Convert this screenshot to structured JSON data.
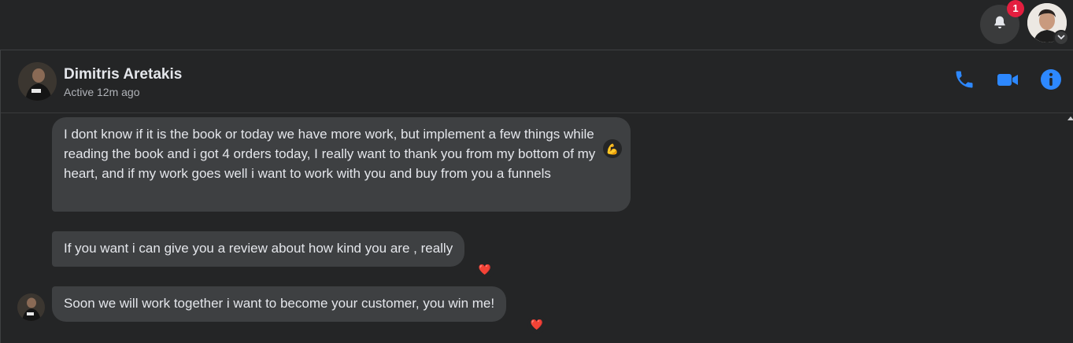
{
  "topbar": {
    "notifications": {
      "icon": "bell-icon",
      "count": "1"
    },
    "profile": {
      "icon": "chevron-down-icon"
    }
  },
  "conversation": {
    "contact": {
      "name": "Dimitris Aretakis",
      "status": "Active 12m ago"
    },
    "actions": [
      {
        "icon": "phone-icon"
      },
      {
        "icon": "video-icon"
      },
      {
        "icon": "info-icon"
      }
    ],
    "accent_color": "#2d88ff",
    "messages": [
      {
        "text": "I dont know if it is the book or today we have more work, but implement a few things while reading the book and i got 4 orders today, I really want to thank you from my bottom of my heart, and if my work goes well i want to work with you and buy from you a funnels",
        "reaction": "💪"
      },
      {
        "text": "If you want i can give you a review about how kind you are , really",
        "reaction": "❤️"
      },
      {
        "text": "Soon we will work together i want to become your customer, you win me!",
        "reaction": "❤️"
      }
    ]
  }
}
